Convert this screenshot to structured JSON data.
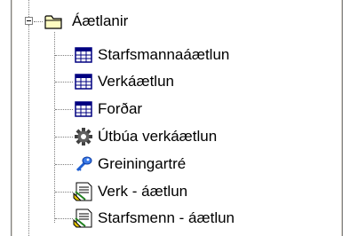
{
  "tree": {
    "root": {
      "label": "Áætlanir",
      "icon": "folder-open-icon",
      "expanded": true
    },
    "children": [
      {
        "label": "Starfsmannaáætlun",
        "icon": "grid-table-icon"
      },
      {
        "label": "Verkáætlun",
        "icon": "grid-table-icon"
      },
      {
        "label": "Forðar",
        "icon": "grid-table-icon"
      },
      {
        "label": "Útbúa verkáætlun",
        "icon": "gear-icon"
      },
      {
        "label": "Greiningartré",
        "icon": "key-icon"
      },
      {
        "label": "Verk - áætlun",
        "icon": "report-document-icon"
      },
      {
        "label": "Starfsmenn - áætlun",
        "icon": "report-document-icon"
      }
    ]
  }
}
